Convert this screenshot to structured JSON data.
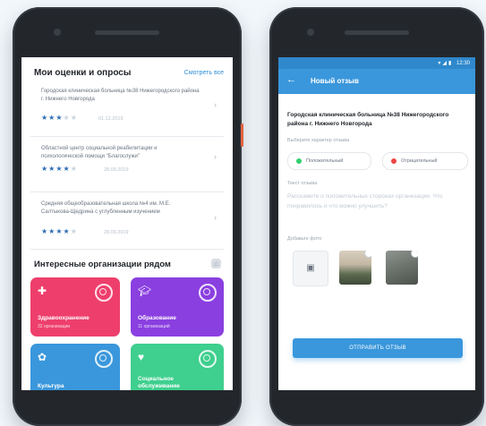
{
  "left_screen": {
    "title": "Мои оценки и опросы",
    "see_all": "Смотреть все",
    "reviews": [
      {
        "text": "Городская клиническая больница №38 Нижегородского района г. Нижнего Новгорода",
        "stars": 3,
        "date": "01.12.2019"
      },
      {
        "text": "Областной центр социальной реабилитации и психологической помощи \"Благослужи\"",
        "stars": 4,
        "date": "28.09.2019"
      },
      {
        "text": "Средняя общеобразовательная школа №4 им. М.Е. Салтыкова-Щедрина с углубленным изучением",
        "stars": 4,
        "date": "28.09.2019"
      }
    ],
    "section_title": "Интересные организации рядом",
    "tiles": [
      {
        "name": "Здравоохранение",
        "sub": "32 организации",
        "color": "#ee3f6c"
      },
      {
        "name": "Образование",
        "sub": "11 организаций",
        "color": "#8a3fe0"
      },
      {
        "name": "Культура",
        "sub": "",
        "color": "#3a97dc"
      },
      {
        "name": "Социальное обслуживание",
        "sub": "",
        "color": "#3fcf8e"
      }
    ]
  },
  "right_screen": {
    "status_time": "12:30",
    "title": "Новый отзыв",
    "org_name": "Городская клиническая больница №38 Нижегородского района г. Нижнего Новгорода",
    "choose_label": "Выберите характер отзыва",
    "positive_label": "Положительный",
    "negative_label": "Отрицательный",
    "text_label": "Текст отзыва",
    "placeholder": "Расскажите о положительных сторонах организации. Что понравилось и что можно улучшить?",
    "photos_label": "Добавьте фото",
    "send_label": "ОТПРАВИТЬ ОТЗЫВ",
    "colors": {
      "positive": "#2fcf6b",
      "negative": "#f04545",
      "accent": "#3a97dc"
    }
  }
}
